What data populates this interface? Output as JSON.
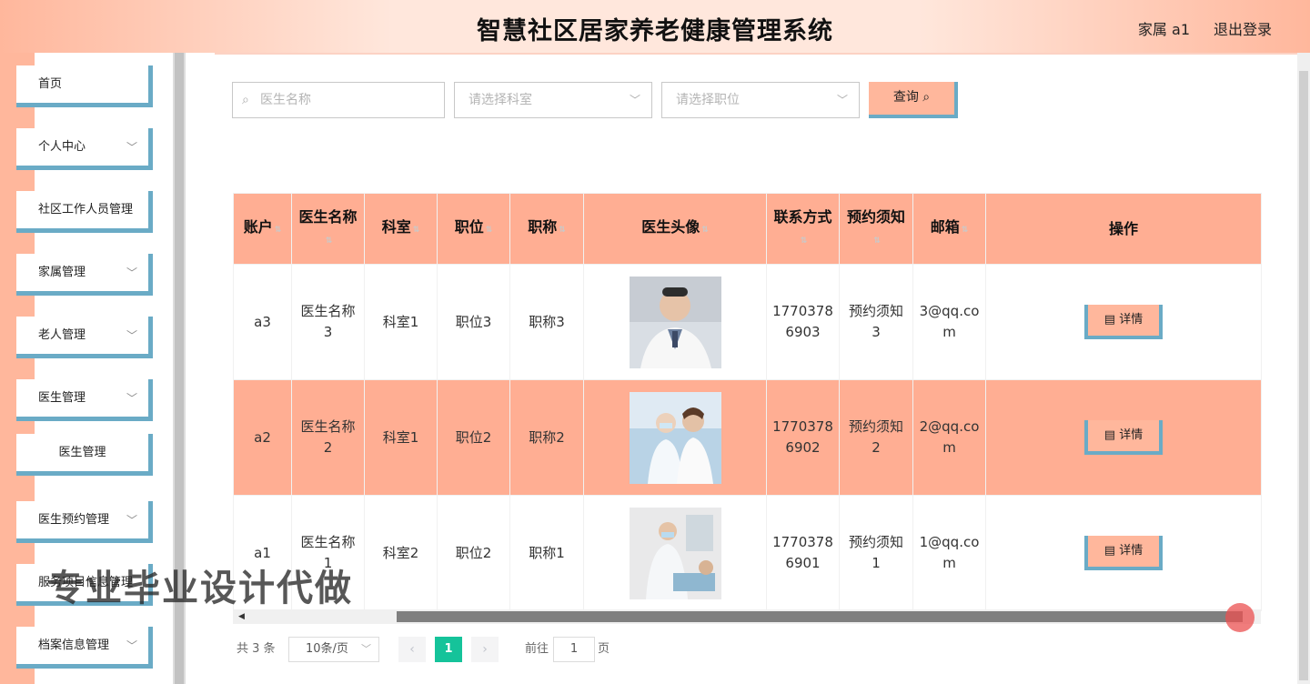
{
  "header": {
    "title": "智慧社区居家养老健康管理系统",
    "user": "家属 a1",
    "logout": "退出登录"
  },
  "sidebar": {
    "items": [
      {
        "label": "首页"
      },
      {
        "label": "个人中心"
      },
      {
        "label": "社区工作人员管理"
      },
      {
        "label": "家属管理"
      },
      {
        "label": "老人管理"
      },
      {
        "label": "医生管理"
      },
      {
        "label": "医生管理"
      },
      {
        "label": "医生预约管理"
      },
      {
        "label": "服务项目信息管理"
      },
      {
        "label": "档案信息管理"
      }
    ]
  },
  "search": {
    "name_placeholder": "医生名称",
    "dept_placeholder": "请选择科室",
    "position_placeholder": "请选择职位",
    "query_label": "查询"
  },
  "table": {
    "headers": [
      "账户",
      "医生名称",
      "科室",
      "职位",
      "职称",
      "医生头像",
      "联系方式",
      "预约须知",
      "邮箱",
      "操作"
    ],
    "rows": [
      {
        "account": "a3",
        "name": "医生名称3",
        "dept": "科室1",
        "position": "职位3",
        "title": "职称3",
        "phone": "17703786903",
        "notice": "预约须知3",
        "email": "3@qq.com",
        "action": "详情"
      },
      {
        "account": "a2",
        "name": "医生名称2",
        "dept": "科室1",
        "position": "职位2",
        "title": "职称2",
        "phone": "17703786902",
        "notice": "预约须知2",
        "email": "2@qq.com",
        "action": "详情"
      },
      {
        "account": "a1",
        "name": "医生名称1",
        "dept": "科室2",
        "position": "职位2",
        "title": "职称1",
        "phone": "17703786901",
        "notice": "预约须知1",
        "email": "1@qq.com",
        "action": "详情"
      }
    ]
  },
  "pagination": {
    "total": "共 3 条",
    "page_size": "10条/页",
    "current": "1",
    "goto_label": "前往",
    "goto_value": "1",
    "page_unit": "页"
  },
  "watermark": "专业毕业设计代做",
  "colors": {
    "accent": "#ffb79c",
    "border_accent": "#6aabc6",
    "pager_active": "#15c39a"
  }
}
